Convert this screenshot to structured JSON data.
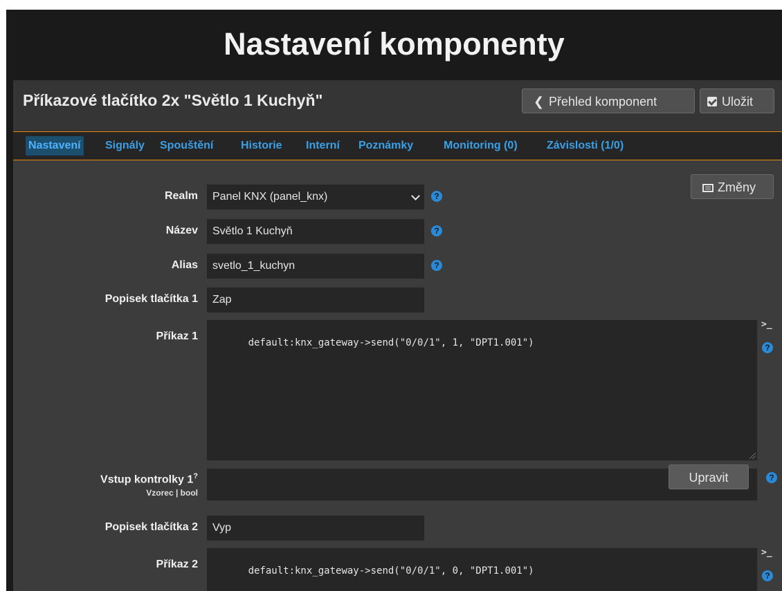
{
  "page": {
    "title": "Nastavení komponenty"
  },
  "header": {
    "component_title": "Příkazové tlačítko 2x \"Světlo 1 Kuchyň\"",
    "back_label": "Přehled komponent",
    "save_label": "Uložit"
  },
  "tabs": [
    {
      "label": "Nastavení",
      "active": true
    },
    {
      "label": "Signály"
    },
    {
      "label": "Spouštění"
    },
    {
      "label": "Historie"
    },
    {
      "label": "Interní"
    },
    {
      "label": "Poznámky"
    },
    {
      "label": "Monitoring (0)"
    },
    {
      "label": "Závislosti (1/0)"
    }
  ],
  "changes_label": "Změny",
  "form": {
    "realm": {
      "label": "Realm",
      "value": "Panel KNX (panel_knx)"
    },
    "name": {
      "label": "Název",
      "value": "Světlo 1 Kuchyň"
    },
    "alias": {
      "label": "Alias",
      "value": "svetlo_1_kuchyn"
    },
    "button_label_1": {
      "label": "Popisek tlačítka 1",
      "value": "Zap"
    },
    "command_1": {
      "label": "Příkaz 1",
      "value": "default:knx_gateway->send(\"0/0/1\", 1, \"DPT1.001\")"
    },
    "indicator_input_1": {
      "label": "Vstup kontrolky 1",
      "sup": "?",
      "sublabel": "Vzorec | bool",
      "value": "",
      "edit_label": "Upravit"
    },
    "button_label_2": {
      "label": "Popisek tlačítka 2",
      "value": "Vyp"
    },
    "command_2": {
      "label": "Příkaz 2",
      "value": "default:knx_gateway->send(\"0/0/1\", 0, \"DPT1.001\")"
    }
  },
  "icons": {
    "help": "question-circle-icon",
    "terminal": "terminal-icon",
    "back": "chevron-left-icon",
    "save": "check-square-icon",
    "changes": "list-icon"
  },
  "colors": {
    "accent": "#e8890c",
    "link": "#3aa0e8",
    "background": "#1a1a1a",
    "panel": "#3c3c3c"
  }
}
